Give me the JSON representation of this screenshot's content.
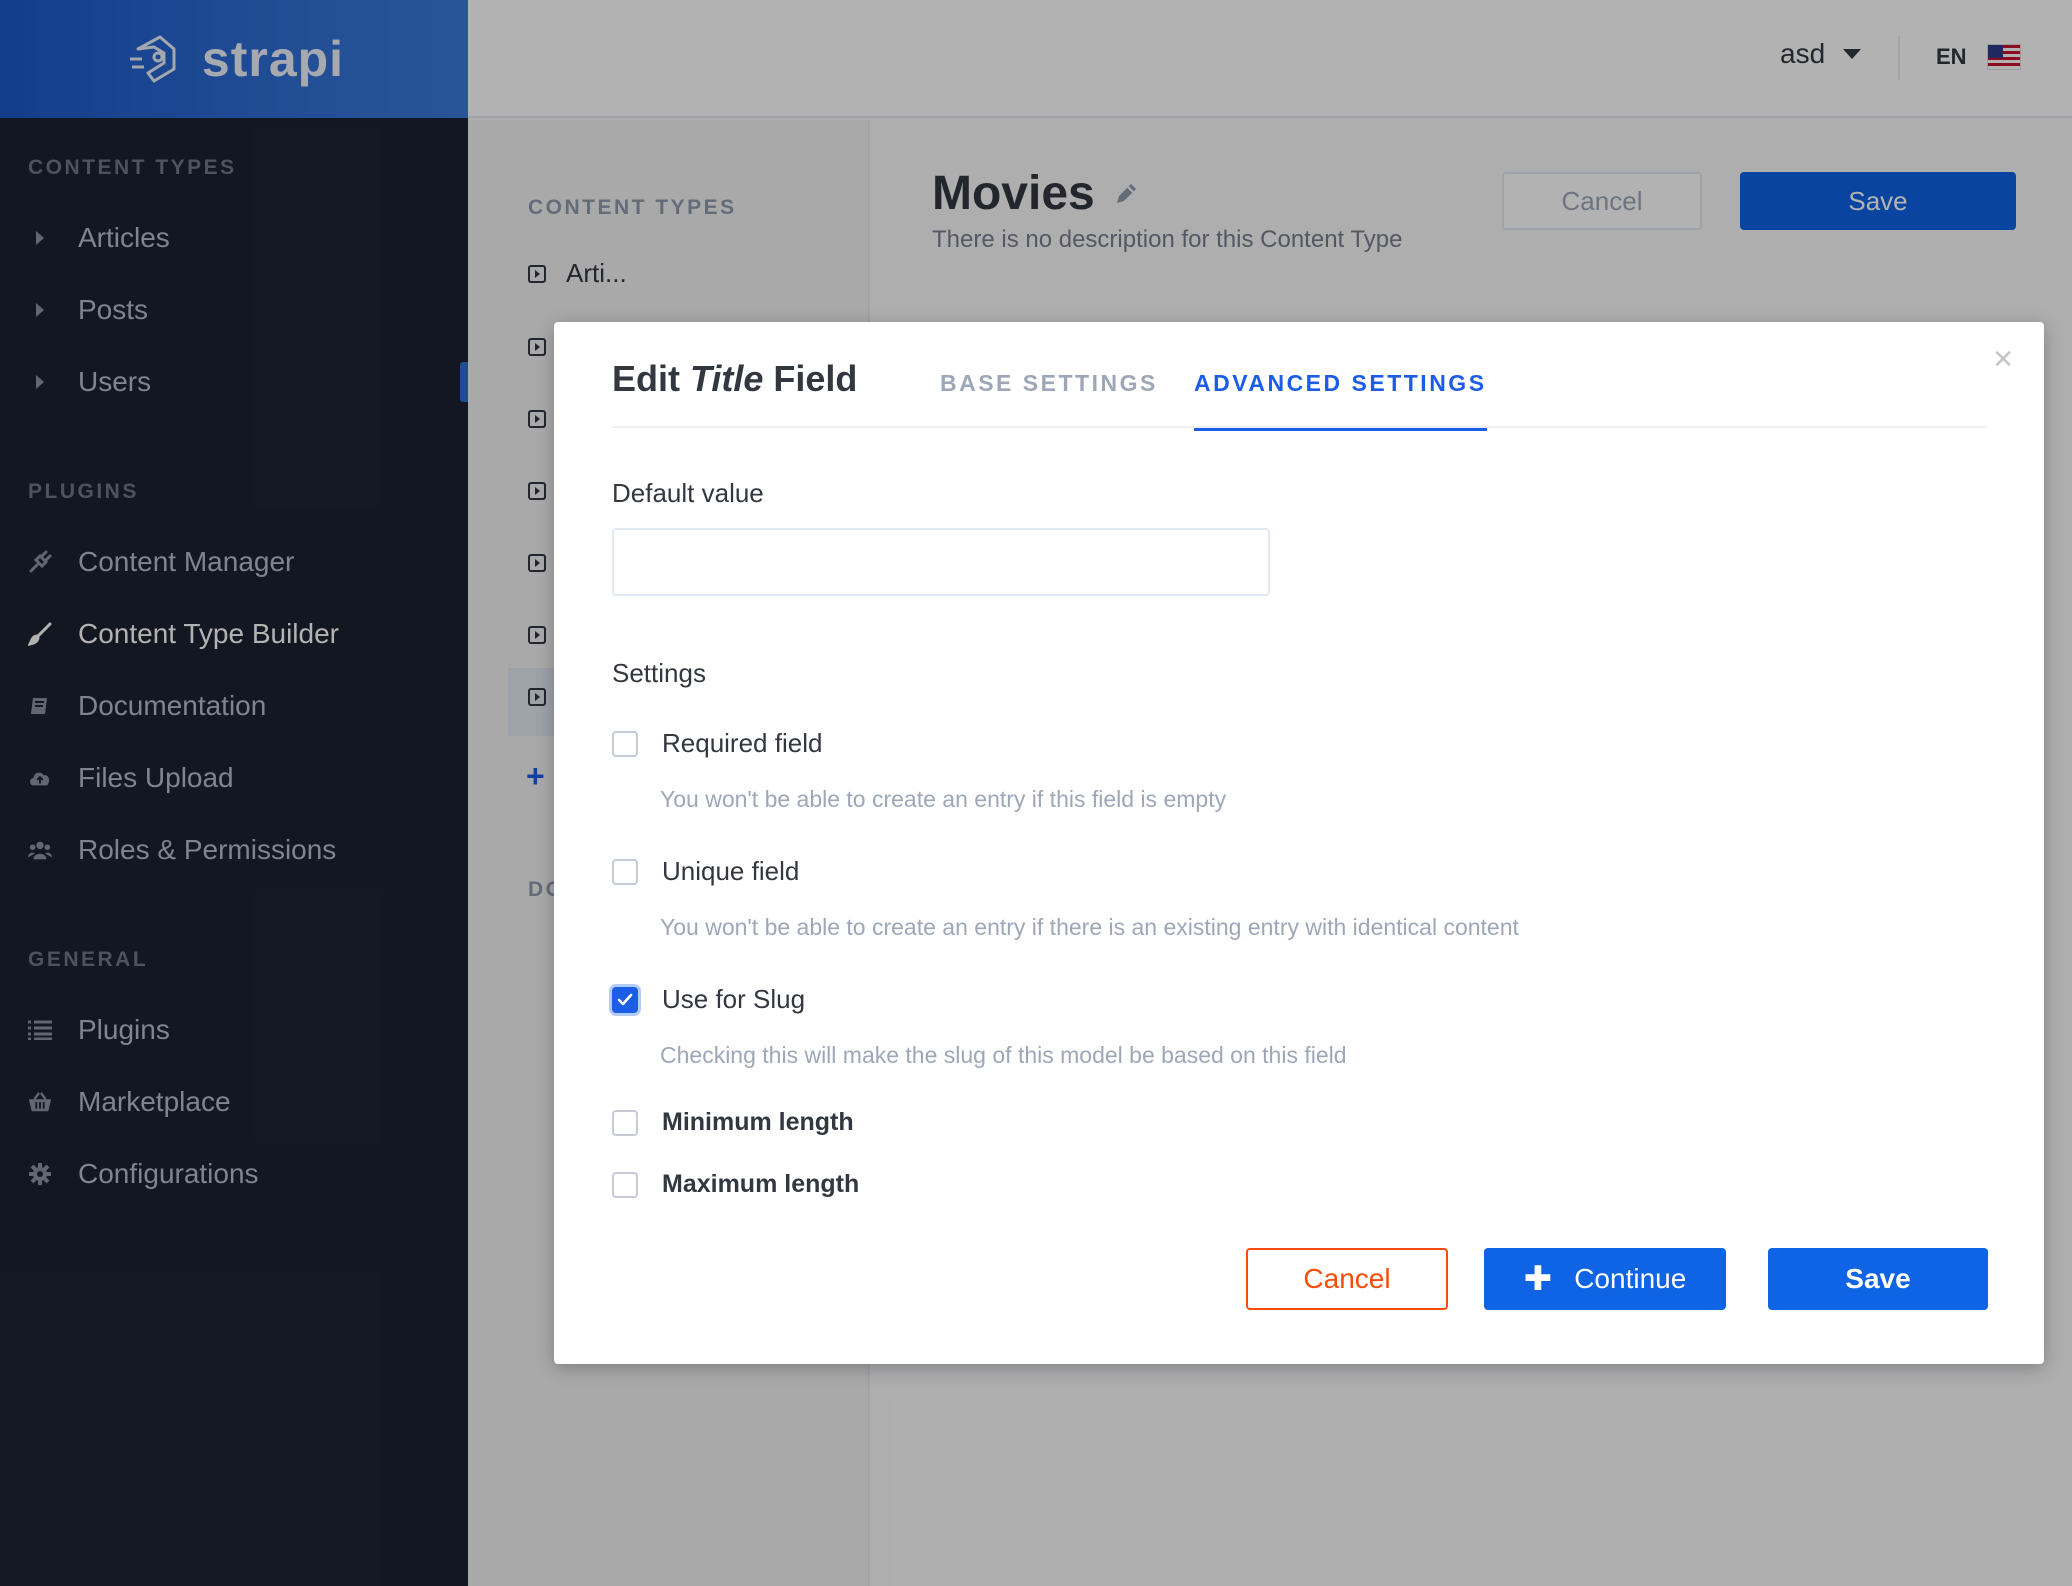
{
  "brand": {
    "name": "strapi"
  },
  "sidebar": {
    "sections": {
      "content_types": "CONTENT TYPES",
      "plugins": "PLUGINS",
      "general": "GENERAL"
    },
    "content_types": [
      {
        "label": "Articles"
      },
      {
        "label": "Posts"
      },
      {
        "label": "Users"
      }
    ],
    "plugins": [
      {
        "label": "Content Manager",
        "icon": "plug-icon"
      },
      {
        "label": "Content Type Builder",
        "icon": "brush-icon",
        "active": true
      },
      {
        "label": "Documentation",
        "icon": "book-icon"
      },
      {
        "label": "Files Upload",
        "icon": "cloud-upload-icon"
      },
      {
        "label": "Roles & Permissions",
        "icon": "users-icon"
      }
    ],
    "general": [
      {
        "label": "Plugins",
        "icon": "list-icon"
      },
      {
        "label": "Marketplace",
        "icon": "basket-icon"
      },
      {
        "label": "Configurations",
        "icon": "gear-icon"
      }
    ]
  },
  "topbar": {
    "user": "asd",
    "language": "EN",
    "flag_icon": "us-flag-icon"
  },
  "ctb_menu": {
    "title": "CONTENT TYPES",
    "first_item": "Arti...",
    "docs_partial": "DO"
  },
  "main": {
    "title": "Movies",
    "description": "There is no description for this Content Type",
    "cancel_label": "Cancel",
    "save_label": "Save"
  },
  "modal": {
    "title_prefix": "Edit ",
    "title_field": "Title",
    "title_suffix": " Field",
    "tabs": {
      "base": "BASE SETTINGS",
      "advanced": "ADVANCED SETTINGS",
      "active": "advanced"
    },
    "default_value_label": "Default value",
    "default_value": "",
    "settings_label": "Settings",
    "options": {
      "required": {
        "label": "Required field",
        "hint": "You won't be able to create an entry if this field is empty",
        "checked": false
      },
      "unique": {
        "label": "Unique field",
        "hint": "You won't be able to create an entry if there is an existing entry with identical content",
        "checked": false
      },
      "slug": {
        "label": "Use for Slug",
        "hint": "Checking this will make the slug of this model be based on this field",
        "checked": true
      },
      "min_length": {
        "label": "Minimum length",
        "checked": false
      },
      "max_length": {
        "label": "Maximum length",
        "checked": false
      }
    },
    "buttons": {
      "cancel": "Cancel",
      "continue": "Continue",
      "save": "Save"
    }
  },
  "colors": {
    "primary": "#0e64e5",
    "danger": "#f64d0a",
    "sidebar_bg": "#1c2231"
  }
}
